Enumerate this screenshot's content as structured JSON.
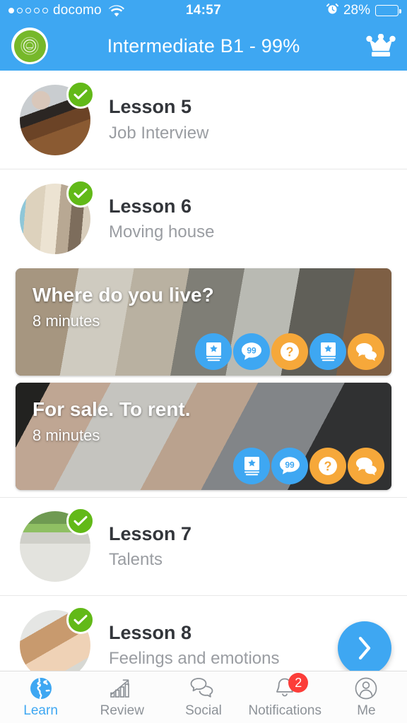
{
  "status_bar": {
    "carrier": "docomo",
    "signal_dots": [
      true,
      false,
      false,
      false,
      false
    ],
    "wifi_icon": "wifi-icon",
    "time": "14:57",
    "alarm_icon": "alarm-clock-icon",
    "battery_percent": "28%",
    "battery_level": 28
  },
  "header": {
    "logo_icon": "app-logo-icon",
    "title": "Intermediate B1 - 99%",
    "crown_icon": "crown-icon",
    "background_color": "#3EA7F2"
  },
  "colors": {
    "accent_blue": "#3EA7F2",
    "accent_orange": "#F6A83A",
    "complete_green": "#62B918",
    "badge_red": "#FC3D39",
    "title_text": "#33363B",
    "subtitle_text": "#9A9DA2",
    "tab_inactive": "#8D9298"
  },
  "lessons": [
    {
      "title": "Lesson 5",
      "subtitle": "Job Interview",
      "completed": true,
      "status_icon": "check-circle-icon",
      "thumb_icon": "lesson-thumbnail-job-interview"
    },
    {
      "title": "Lesson 6",
      "subtitle": "Moving house",
      "completed": true,
      "status_icon": "check-circle-icon",
      "thumb_icon": "lesson-thumbnail-moving-house"
    },
    {
      "title": "Lesson 7",
      "subtitle": "Talents",
      "completed": true,
      "status_icon": "check-circle-icon",
      "thumb_icon": "lesson-thumbnail-talents"
    },
    {
      "title": "Lesson 8",
      "subtitle": "Feelings and emotions",
      "completed": true,
      "status_icon": "check-circle-icon",
      "thumb_icon": "lesson-thumbnail-feelings"
    }
  ],
  "activity_cards": [
    {
      "title": "Where do you live?",
      "duration": "8 minutes",
      "background_icon": "card-background-laundry-balcony",
      "activities": [
        {
          "icon": "vocabulary-book-icon",
          "color": "blue"
        },
        {
          "icon": "quote-bubble-icon",
          "color": "blue"
        },
        {
          "icon": "question-mark-icon",
          "color": "orange"
        },
        {
          "icon": "vocabulary-book-icon",
          "color": "blue"
        },
        {
          "icon": "chat-bubbles-icon",
          "color": "orange"
        }
      ]
    },
    {
      "title": "For sale. To rent.",
      "duration": "8 minutes",
      "background_icon": "card-background-hands-laptop",
      "activities": [
        {
          "icon": "vocabulary-book-icon",
          "color": "blue"
        },
        {
          "icon": "quote-bubble-icon",
          "color": "blue"
        },
        {
          "icon": "question-mark-icon",
          "color": "orange"
        },
        {
          "icon": "chat-bubbles-icon",
          "color": "orange"
        }
      ]
    }
  ],
  "fab": {
    "icon": "chevron-right-icon",
    "color": "#3EA7F2"
  },
  "tabbar": {
    "items": [
      {
        "label": "Learn",
        "icon": "globe-icon",
        "active": true,
        "badge": null
      },
      {
        "label": "Review",
        "icon": "bar-chart-up-icon",
        "active": false,
        "badge": null
      },
      {
        "label": "Social",
        "icon": "chat-bubbles-icon",
        "active": false,
        "badge": null
      },
      {
        "label": "Notifications",
        "icon": "bell-icon",
        "active": false,
        "badge": "2"
      },
      {
        "label": "Me",
        "icon": "user-avatar-icon",
        "active": false,
        "badge": null
      }
    ]
  }
}
